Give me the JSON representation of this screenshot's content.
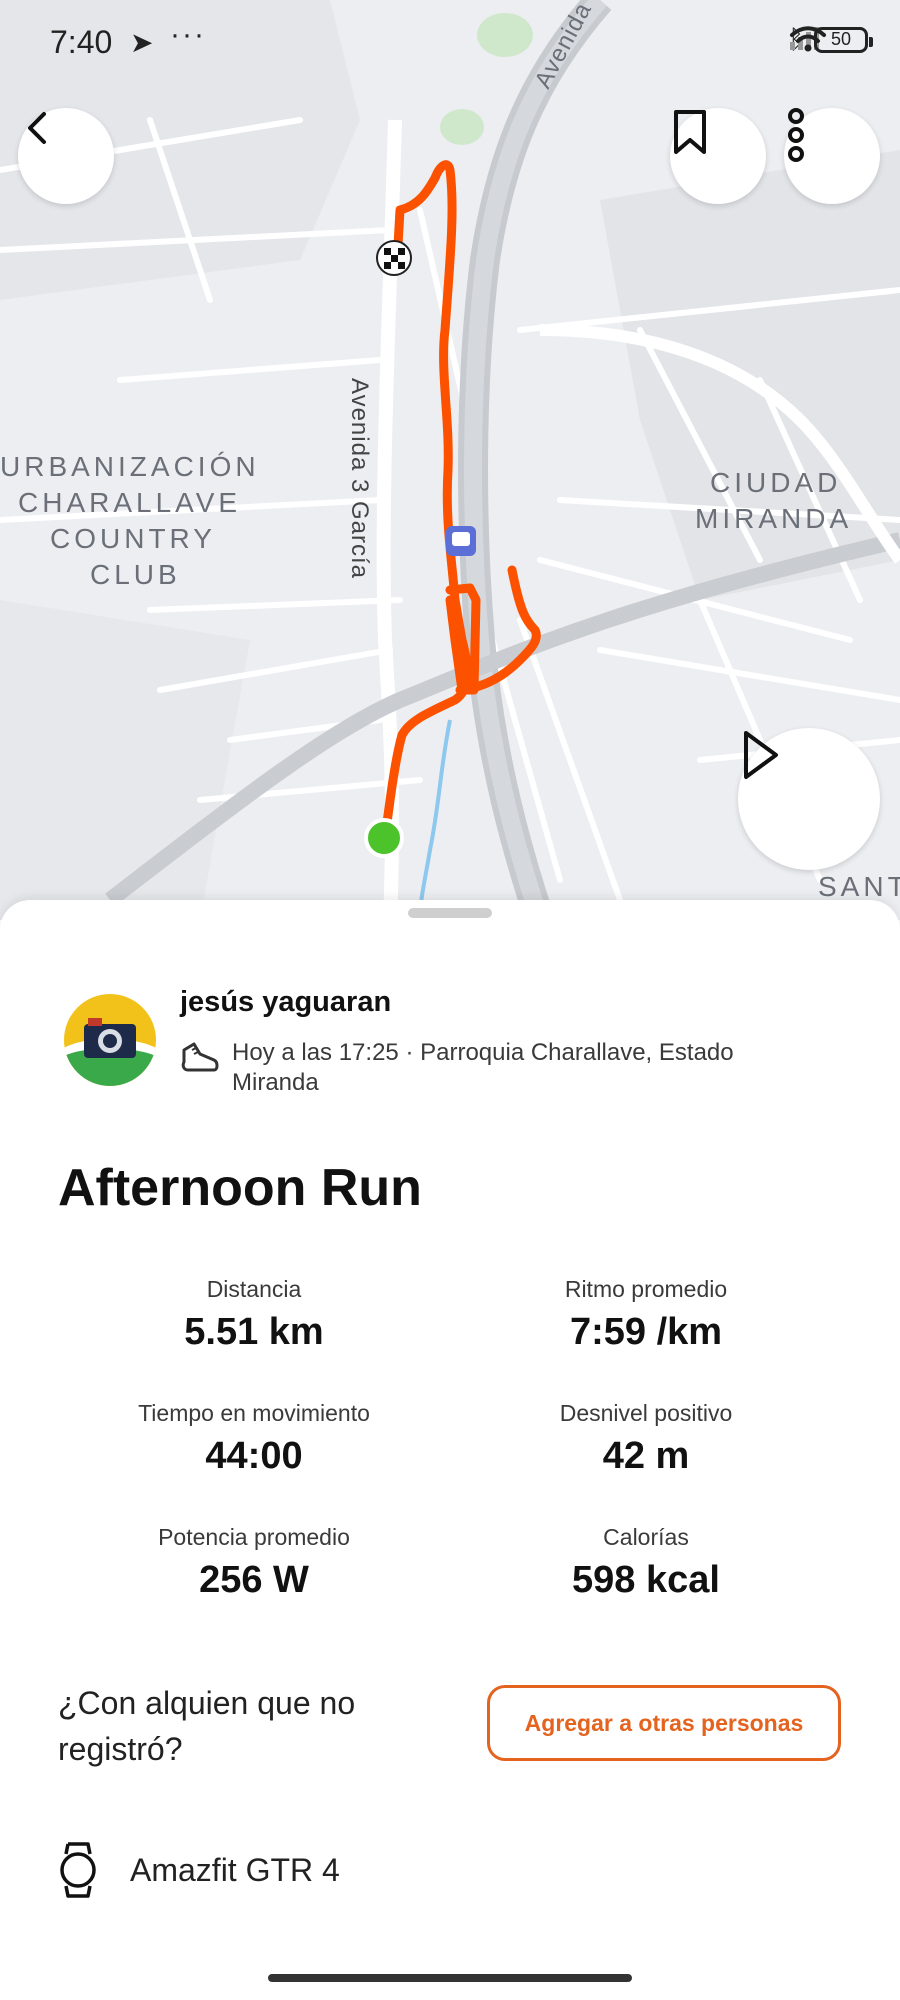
{
  "status_bar": {
    "time": "7:40",
    "battery": "50"
  },
  "map": {
    "labels": {
      "avenida_top": "Avenida",
      "avenida_garcia": "Avenida 3 García",
      "urbanizacion": [
        "URBANIZACIÓN",
        "CHARALLAVE",
        "COUNTRY",
        "CLUB"
      ],
      "ciudad_miranda": [
        "CIUDAD",
        "MIRANDA"
      ],
      "santa_partial": "SANT"
    },
    "route_color": "#fc5200",
    "start_marker_color": "#4cc22b"
  },
  "icons": {
    "back": "chevron-left-icon",
    "bookmark": "bookmark-icon",
    "more": "more-vertical-icon",
    "play": "play-icon",
    "shoe": "running-shoe-icon",
    "watch": "watch-icon"
  },
  "activity": {
    "athlete_name": "jesús yaguaran",
    "meta": "Hoy a las 17:25 · Parroquia Charallave, Estado Miranda",
    "title": "Afternoon Run"
  },
  "stats": [
    {
      "label": "Distancia",
      "value": "5.51 km"
    },
    {
      "label": "Ritmo promedio",
      "value": "7:59 /km"
    },
    {
      "label": "Tiempo en movimiento",
      "value": "44:00"
    },
    {
      "label": "Desnivel positivo",
      "value": "42 m"
    },
    {
      "label": "Potencia promedio",
      "value": "256 W"
    },
    {
      "label": "Calorías",
      "value": "598 kcal"
    }
  ],
  "others": {
    "question": "¿Con alquien que no registró?",
    "button": "Agregar a otras personas"
  },
  "device": {
    "name": "Amazfit GTR 4"
  },
  "colors": {
    "accent": "#e3631f"
  }
}
